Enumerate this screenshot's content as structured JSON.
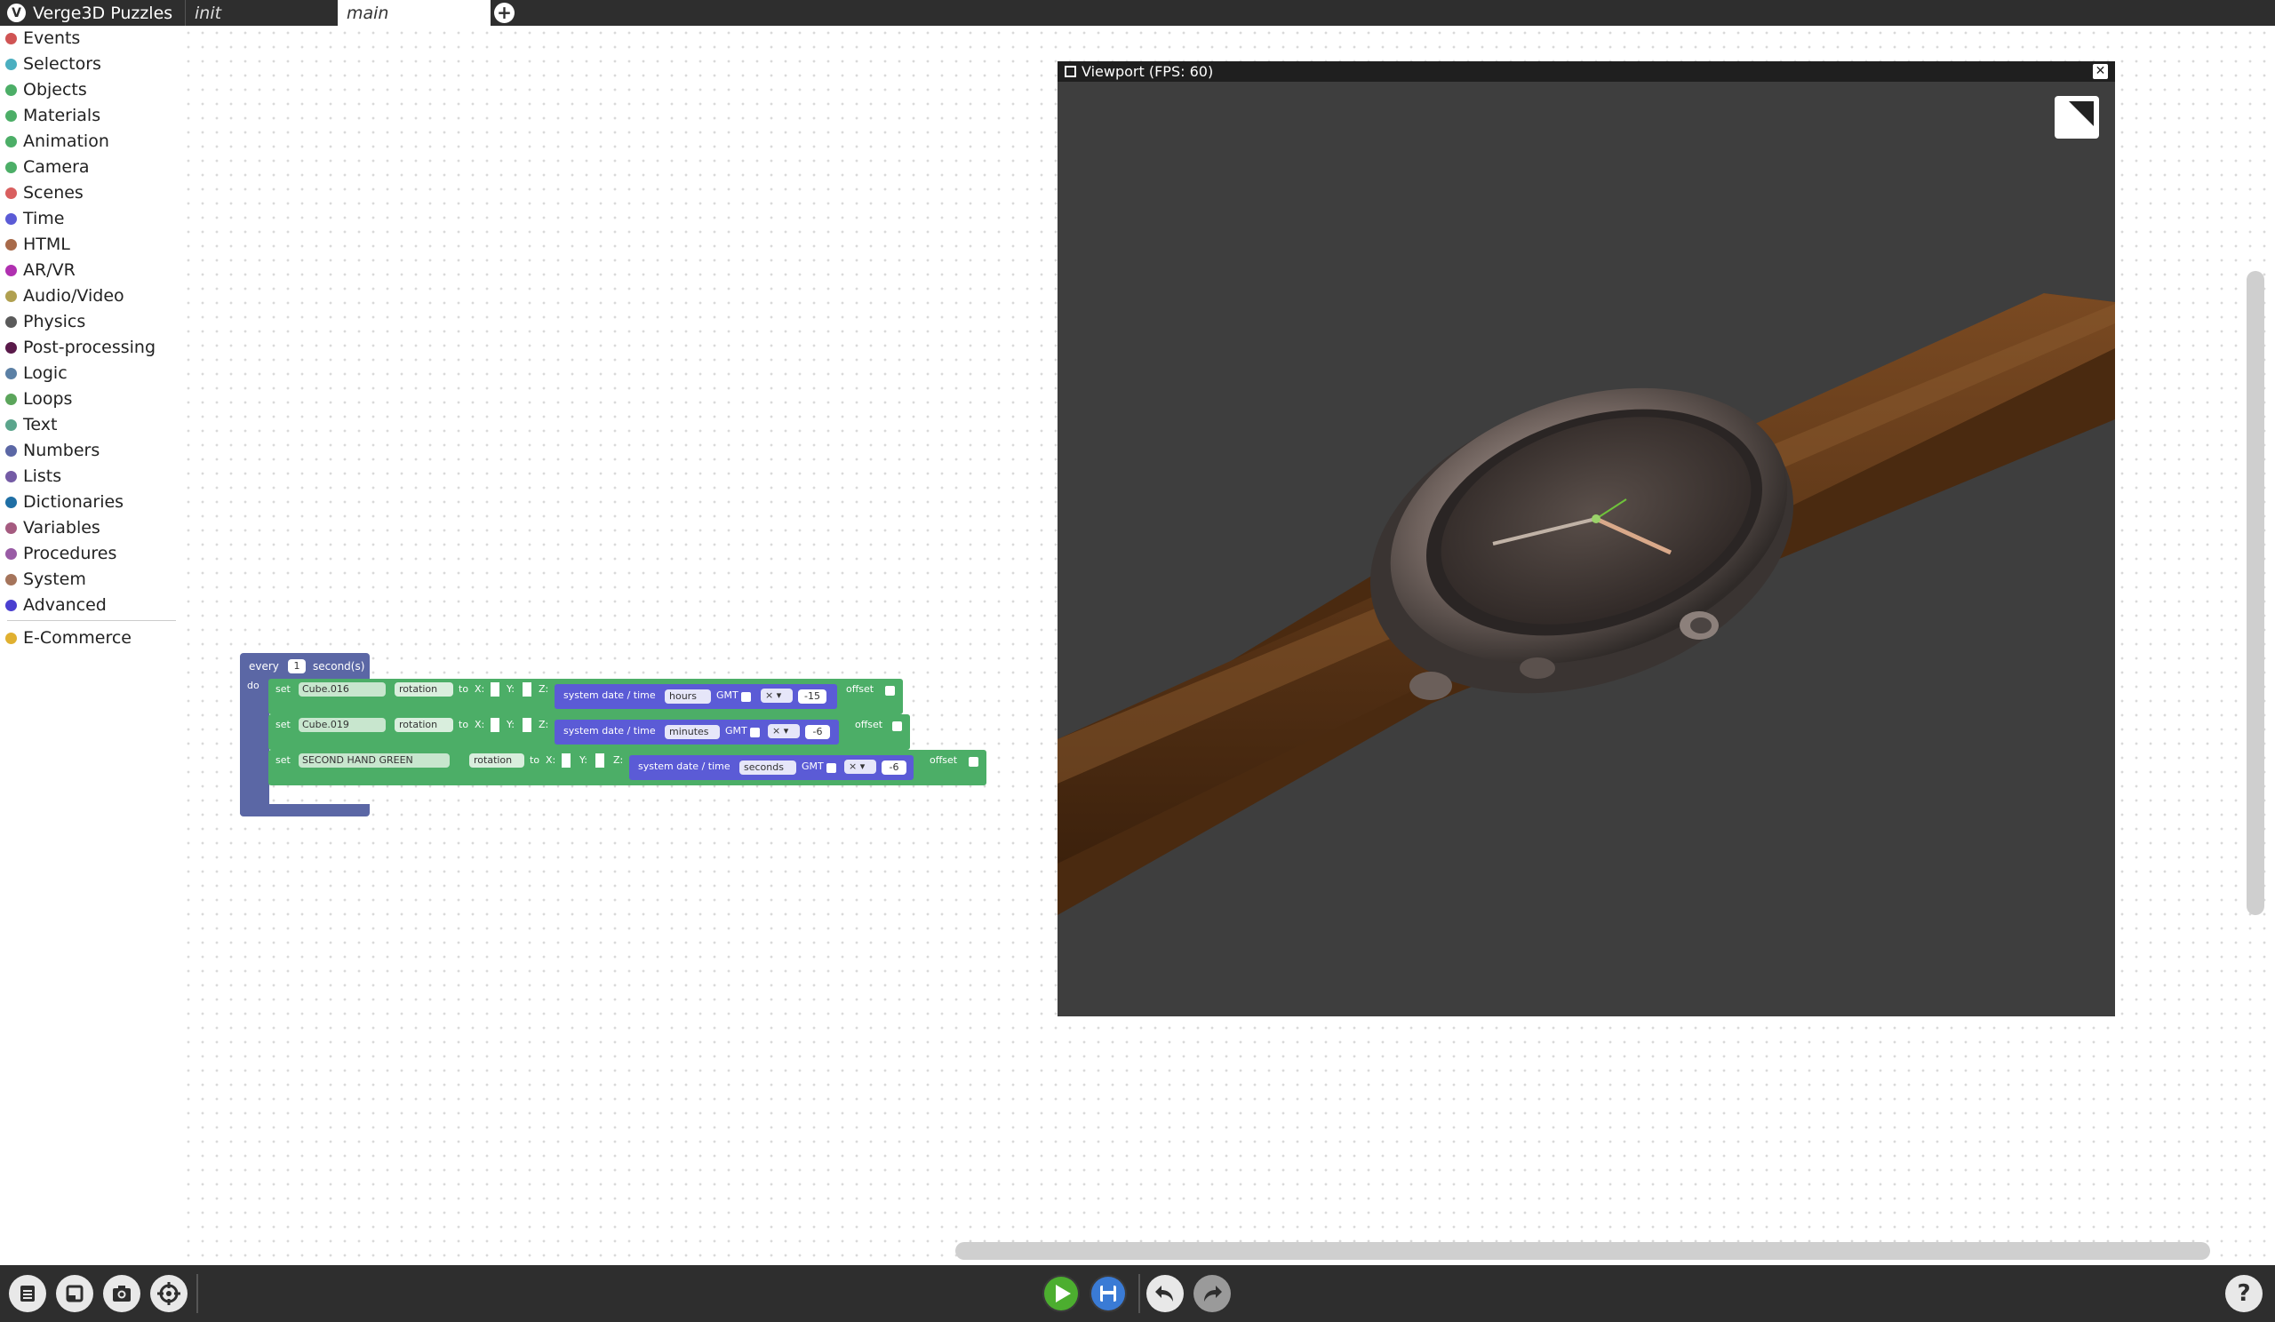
{
  "app": {
    "title": "Verge3D Puzzles"
  },
  "tabs": [
    {
      "label": "init"
    },
    {
      "label": "main"
    }
  ],
  "add_tab_icon": "plus-icon",
  "toolbox": {
    "categories": [
      {
        "label": "Events",
        "color": "#d05454"
      },
      {
        "label": "Selectors",
        "color": "#4bafc0"
      },
      {
        "label": "Objects",
        "color": "#4cae67"
      },
      {
        "label": "Materials",
        "color": "#4cae67"
      },
      {
        "label": "Animation",
        "color": "#4cae67"
      },
      {
        "label": "Camera",
        "color": "#4cae67"
      },
      {
        "label": "Scenes",
        "color": "#d95f5f"
      },
      {
        "label": "Time",
        "color": "#5b5bd6"
      },
      {
        "label": "HTML",
        "color": "#a86a4a"
      },
      {
        "label": "AR/VR",
        "color": "#b030b0"
      },
      {
        "label": "Audio/Video",
        "color": "#b0a050"
      },
      {
        "label": "Physics",
        "color": "#5a5a5a"
      },
      {
        "label": "Post-processing",
        "color": "#5a1a4a"
      },
      {
        "label": "Logic",
        "color": "#5b80a5"
      },
      {
        "label": "Loops",
        "color": "#5ba55b"
      },
      {
        "label": "Text",
        "color": "#5ba58c"
      },
      {
        "label": "Numbers",
        "color": "#5b67a5"
      },
      {
        "label": "Lists",
        "color": "#745ba5"
      },
      {
        "label": "Dictionaries",
        "color": "#1f6fa5"
      },
      {
        "label": "Variables",
        "color": "#a55b80"
      },
      {
        "label": "Procedures",
        "color": "#995ba5"
      },
      {
        "label": "System",
        "color": "#a5745b"
      },
      {
        "label": "Advanced",
        "color": "#4a3fd0"
      }
    ],
    "extra": {
      "label": "E-Commerce",
      "color": "#e0b030"
    }
  },
  "puzzle": {
    "every_label": "every",
    "interval": "1",
    "unit_label": "second(s)",
    "do_label": "do",
    "rows": [
      {
        "set": "set",
        "object": "Cube.016",
        "prop": "rotation",
        "to": "to",
        "x": "X:",
        "y": "Y:",
        "z": "Z:",
        "time_label": "system date / time",
        "time_unit": "hours",
        "gmt": "GMT",
        "op": "× ▾",
        "value": "-15",
        "offset": "offset"
      },
      {
        "set": "set",
        "object": "Cube.019",
        "prop": "rotation",
        "to": "to",
        "x": "X:",
        "y": "Y:",
        "z": "Z:",
        "time_label": "system date / time",
        "time_unit": "minutes",
        "gmt": "GMT",
        "op": "× ▾",
        "value": "-6",
        "offset": "offset"
      },
      {
        "set": "set",
        "object": "SECOND HAND GREEN",
        "prop": "rotation",
        "to": "to",
        "x": "X:",
        "y": "Y:",
        "z": "Z:",
        "time_label": "system date / time",
        "time_unit": "seconds",
        "gmt": "GMT",
        "op": "× ▾",
        "value": "-6",
        "offset": "offset"
      }
    ]
  },
  "viewport": {
    "title": "Viewport (FPS: 60)",
    "close_icon": "close-icon",
    "fullscreen_icon": "fullscreen-icon"
  },
  "bottom_toolbar": {
    "left_icons": [
      "menu-icon",
      "window-icon",
      "screenshot-icon",
      "target-icon"
    ],
    "center_icons": [
      "play-icon",
      "save-icon",
      "undo-icon",
      "redo-icon"
    ],
    "right_icons": [
      "help-icon"
    ],
    "help_label": "?"
  },
  "colors": {
    "topbar": "#2e2e2e",
    "loop_block": "#5b67a5",
    "object_block": "#4cae67",
    "time_block": "#5b5bd6",
    "play": "#4cae2f",
    "save": "#3a7bd5"
  }
}
